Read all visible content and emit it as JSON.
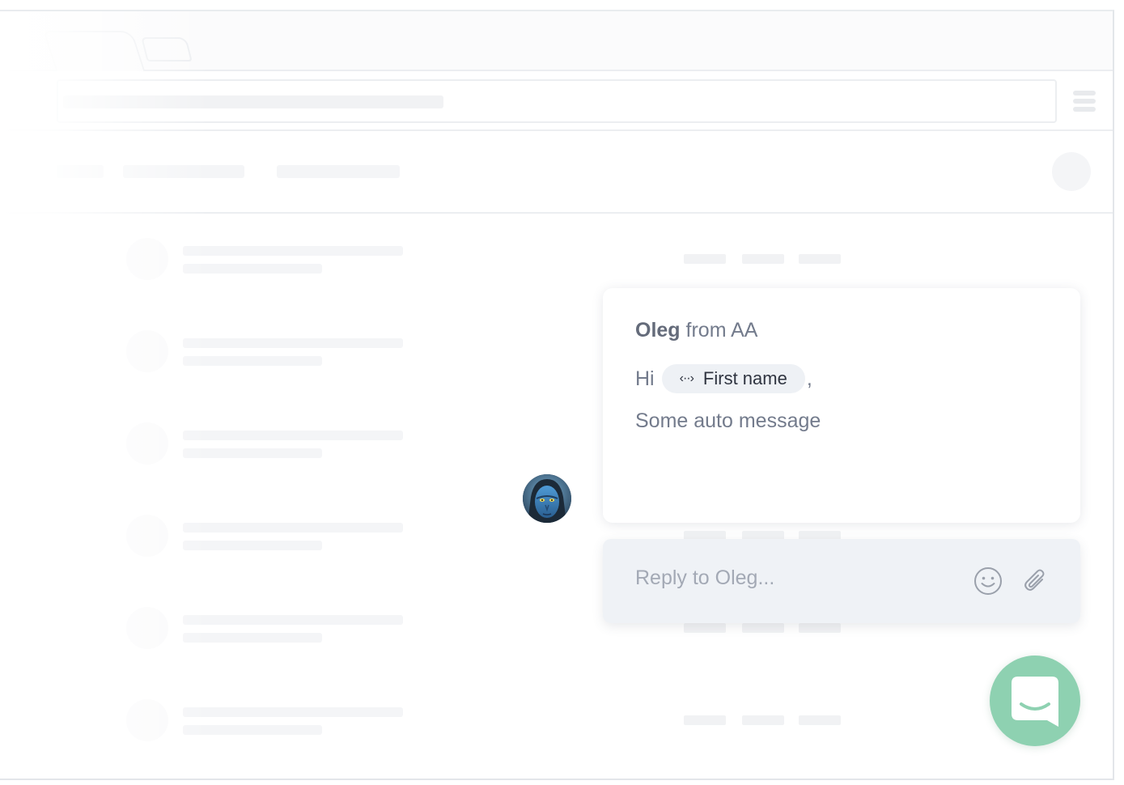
{
  "messenger": {
    "sender_name": "Oleg",
    "sender_suffix": "from AA",
    "greeting": "Hi",
    "attribute_label": "First name",
    "attribute_icon": "code-brackets-icon",
    "greeting_punct": ",",
    "body": "Some auto message",
    "reply_placeholder": "Reply to Oleg...",
    "emoji_icon": "smiley-icon",
    "attach_icon": "paperclip-icon",
    "launcher_icon": "chat-icon"
  },
  "colors": {
    "launcher": "#8ed1b1",
    "pill_bg": "#eef1f5",
    "reply_bg": "#eff2f6"
  }
}
